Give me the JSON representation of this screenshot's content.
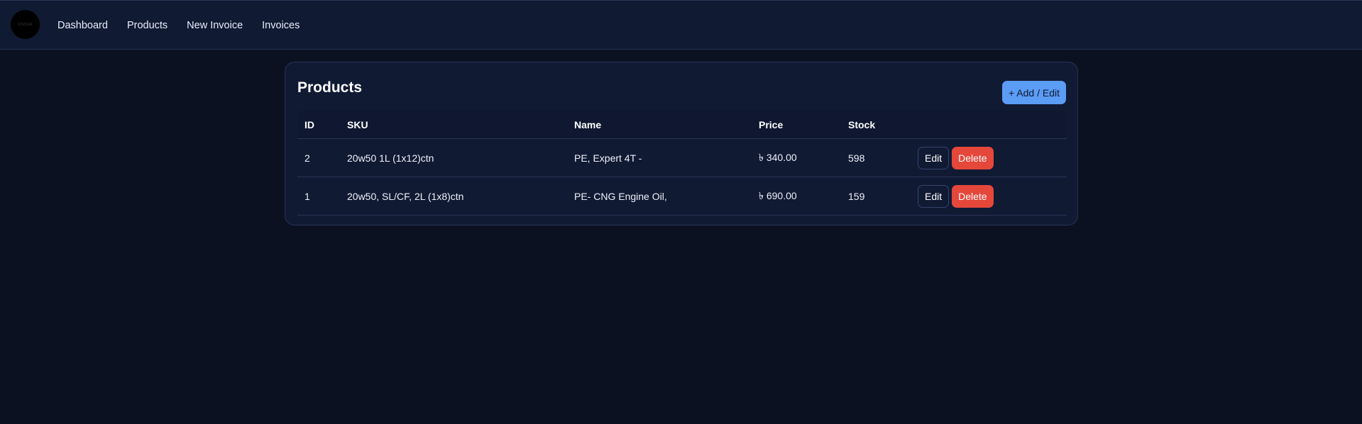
{
  "header": {
    "logo_text": "OSOUR",
    "nav": [
      {
        "label": "Dashboard"
      },
      {
        "label": "Products"
      },
      {
        "label": "New Invoice"
      },
      {
        "label": "Invoices"
      }
    ]
  },
  "products": {
    "title": "Products",
    "add_button_label": "+ Add / Edit",
    "columns": {
      "id": "ID",
      "sku": "SKU",
      "name": "Name",
      "price": "Price",
      "stock": "Stock"
    },
    "rows": [
      {
        "id": "2",
        "sku": "20w50 1L (1x12)ctn",
        "name": "PE, Expert 4T -",
        "price": "৳ 340.00",
        "stock": "598",
        "edit_label": "Edit",
        "delete_label": "Delete"
      },
      {
        "id": "1",
        "sku": "20w50, SL/CF, 2L (1x8)ctn",
        "name": "PE- CNG Engine Oil,",
        "price": "৳ 690.00",
        "stock": "159",
        "edit_label": "Edit",
        "delete_label": "Delete"
      }
    ]
  },
  "colors": {
    "background": "#0b1120",
    "surface": "#111a33",
    "accent": "#5b9cf5",
    "danger": "#e5473b"
  }
}
